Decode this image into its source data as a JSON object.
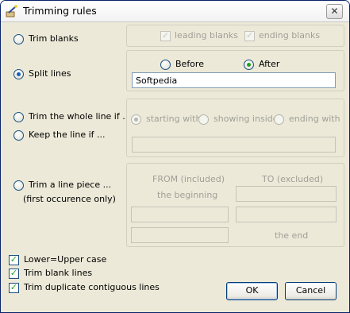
{
  "window": {
    "title": "Trimming rules",
    "close_glyph": "✕",
    "app_icon": "magic-wand-icon"
  },
  "trim_blanks": {
    "label": "Trim blanks",
    "selected": false,
    "leading_label": "leading blanks",
    "leading_checked": true,
    "ending_label": "ending blanks",
    "ending_checked": true
  },
  "split_lines": {
    "label": "Split lines",
    "selected": true,
    "before_label": "Before",
    "after_label": "After",
    "after_selected": true,
    "value": "Softpedia"
  },
  "trim_whole": {
    "label": "Trim the whole line if ...",
    "selected": false
  },
  "keep_line": {
    "label": "Keep the line if ...",
    "selected": false
  },
  "condition": {
    "starting_label": "starting with",
    "showing_label": "showing inside",
    "ending_label": "ending with",
    "value": ""
  },
  "trim_piece": {
    "label": "Trim a line piece ...",
    "note": "(first occurence only)",
    "selected": false,
    "from_header": "FROM (included)",
    "to_header": "TO (excluded)",
    "from_beginning": "the beginning",
    "to_end": "the end",
    "to_first_value": "",
    "from_second_value": "",
    "to_second_value": "",
    "from_third_value": ""
  },
  "options": {
    "lower_upper": {
      "label": "Lower=Upper case",
      "checked": true
    },
    "trim_blank_lines": {
      "label": "Trim blank lines",
      "checked": true
    },
    "trim_duplicates": {
      "label": "Trim duplicate contiguous lines",
      "checked": true
    }
  },
  "buttons": {
    "ok": "OK",
    "cancel": "Cancel"
  }
}
